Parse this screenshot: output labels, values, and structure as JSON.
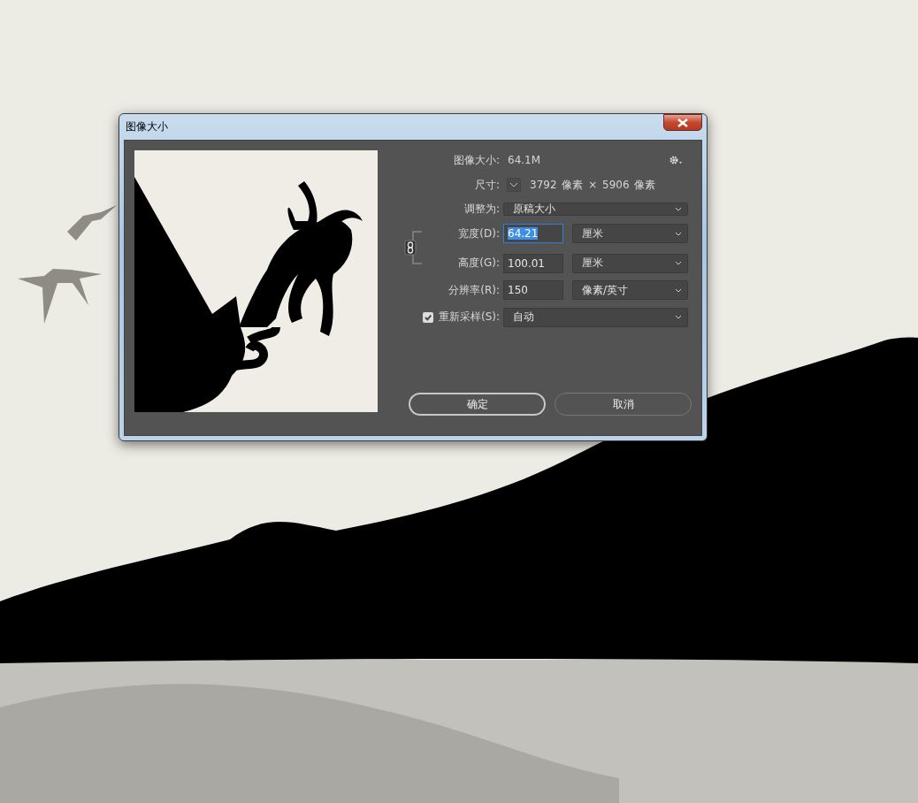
{
  "window": {
    "title": "图像大小"
  },
  "image_size": {
    "label": "图像大小:",
    "value": "64.1M"
  },
  "dimensions": {
    "label": "尺寸:",
    "value": "3792 像素 × 5906 像素"
  },
  "fit_to": {
    "label": "调整为:",
    "value": "原稿大小"
  },
  "fields": [
    {
      "label": "宽度(D):",
      "value": "64.21",
      "unit": "厘米",
      "selected": true
    },
    {
      "label": "高度(G):",
      "value": "100.01",
      "unit": "厘米",
      "selected": false
    },
    {
      "label": "分辨率(R):",
      "value": "150",
      "unit": "像素/英寸",
      "selected": false
    }
  ],
  "resample": {
    "label": "重新采样(S):",
    "checked": true,
    "value": "自动"
  },
  "buttons": [
    {
      "label": "确定",
      "default": true
    },
    {
      "label": "取消",
      "default": false
    }
  ]
}
